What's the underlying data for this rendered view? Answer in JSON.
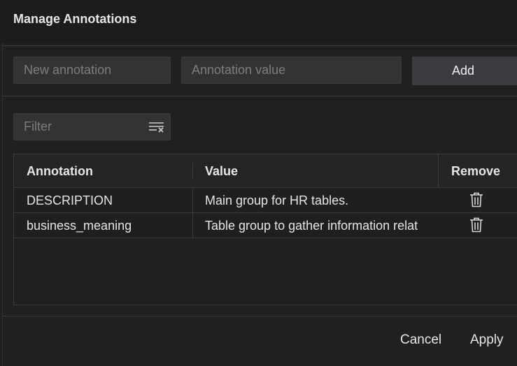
{
  "dialog": {
    "title": "Manage Annotations"
  },
  "form": {
    "name_placeholder": "New annotation",
    "value_placeholder": "Annotation value",
    "add_label": "Add"
  },
  "filter": {
    "placeholder": "Filter",
    "clear_icon": "clear-filter-icon"
  },
  "table": {
    "columns": [
      "Annotation",
      "Value",
      "Remove"
    ],
    "rows": [
      {
        "annotation": "DESCRIPTION",
        "value": "Main group for HR tables.",
        "remove_icon": "trash-icon"
      },
      {
        "annotation": "business_meaning",
        "value": "Table group to gather information relat",
        "remove_icon": "trash-icon"
      }
    ]
  },
  "footer": {
    "cancel_label": "Cancel",
    "apply_label": "Apply"
  }
}
